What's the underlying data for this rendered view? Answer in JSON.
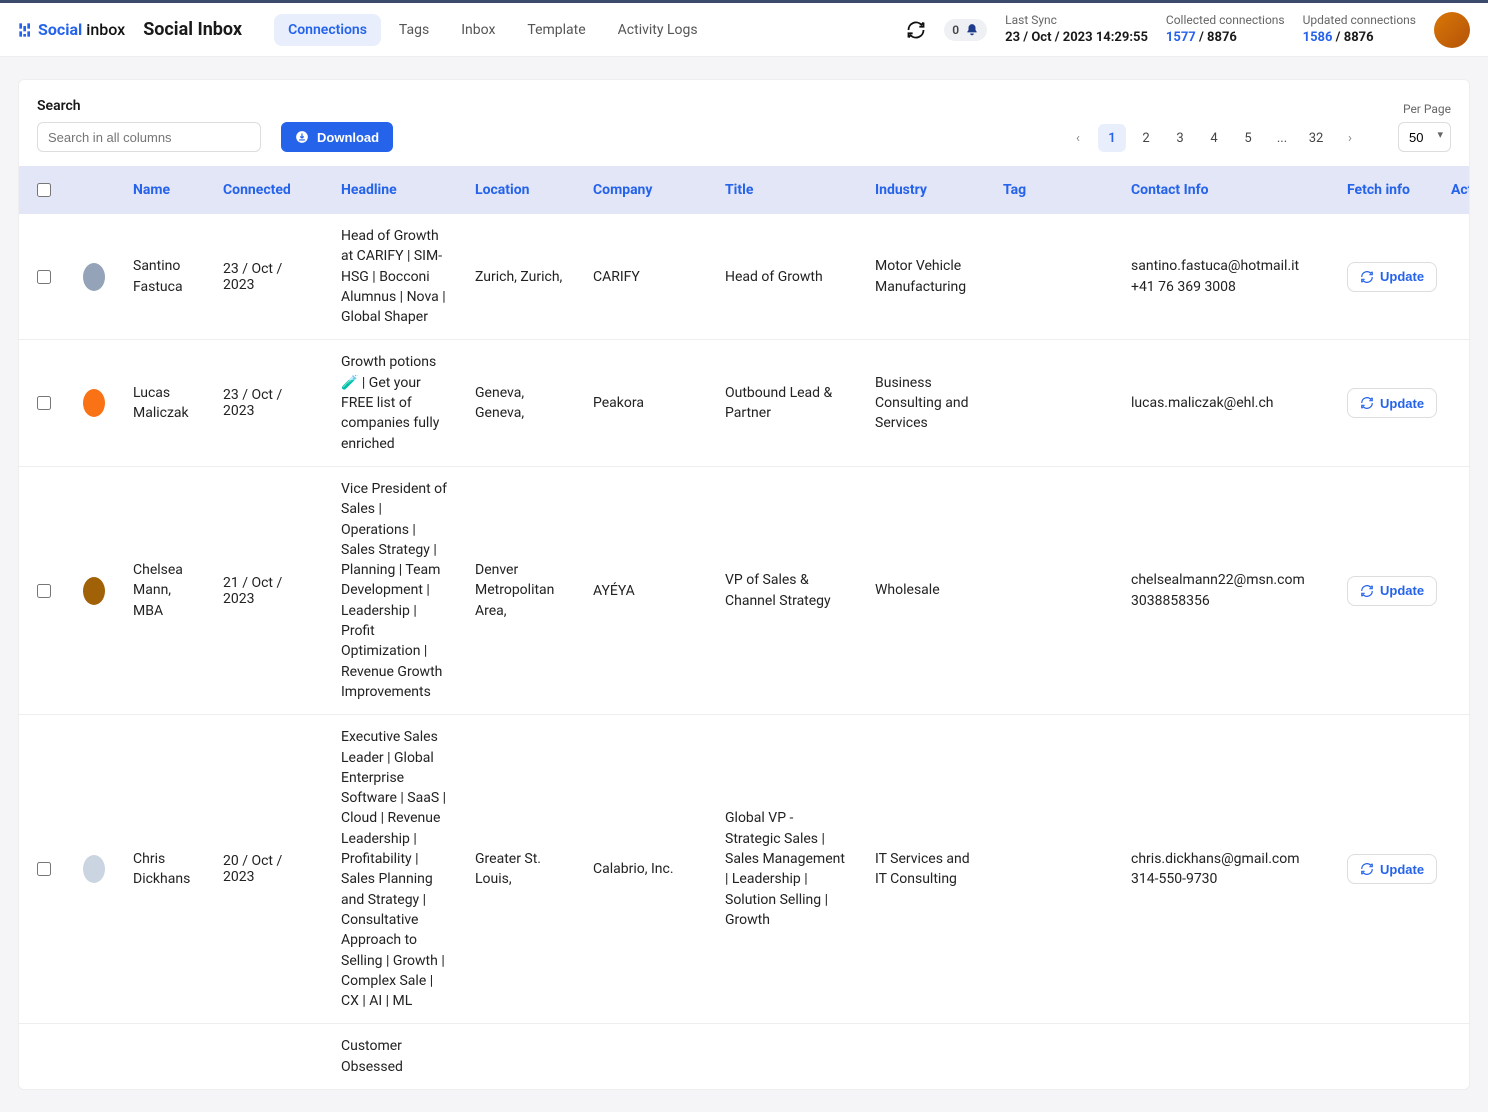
{
  "brand": {
    "social": "Social",
    "inbox": "inbox"
  },
  "app_title": "Social Inbox",
  "nav": [
    "Connections",
    "Tags",
    "Inbox",
    "Template",
    "Activity Logs"
  ],
  "nav_active_index": 0,
  "notif_count": "0",
  "stats": {
    "last_sync": {
      "label": "Last Sync",
      "value": "23 / Oct / 2023 14:29:55"
    },
    "collected": {
      "label": "Collected connections",
      "blue": "1577",
      "rest": " / 8876"
    },
    "updated": {
      "label": "Updated connections",
      "blue": "1586",
      "rest": " / 8876"
    }
  },
  "search": {
    "label": "Search",
    "placeholder": "Search in all columns"
  },
  "download_label": "Download",
  "pagination": {
    "pages": [
      "1",
      "2",
      "3",
      "4",
      "5",
      "...",
      "32"
    ],
    "active_index": 0,
    "per_page_label": "Per Page",
    "per_page_value": "50"
  },
  "columns": [
    "Name",
    "Connected",
    "Headline",
    "Location",
    "Company",
    "Title",
    "Industry",
    "Tag",
    "Contact Info",
    "Fetch info",
    "Action"
  ],
  "update_label": "Update",
  "rows": [
    {
      "name": "Santino Fastuca",
      "connected": "23 / Oct / 2023",
      "headline": "Head of Growth at CARIFY | SIM-HSG | Bocconi Alumnus | Nova | Global Shaper",
      "location": "Zurich, Zurich,",
      "company": "CARIFY",
      "title": "Head of Growth",
      "industry": "Motor Vehicle Manufacturing",
      "contact_email": "santino.fastuca@hotmail.it",
      "contact_phone": "+41 76 369 3008",
      "avatar_bg": "#94a3b8"
    },
    {
      "name": "Lucas Maliczak",
      "connected": "23 / Oct / 2023",
      "headline": "Growth potions 🧪 | Get your FREE list of companies fully enriched",
      "location": "Geneva, Geneva,",
      "company": "Peakora",
      "title": "Outbound Lead & Partner",
      "industry": "Business Consulting and Services",
      "contact_email": "lucas.maliczak@ehl.ch",
      "contact_phone": "",
      "avatar_bg": "#f97316"
    },
    {
      "name": "Chelsea Mann, MBA",
      "connected": "21 / Oct / 2023",
      "headline": "Vice President of Sales | Operations | Sales Strategy | Planning | Team Development | Leadership | Profit Optimization | Revenue Growth Improvements",
      "location": "Denver Metropolitan Area,",
      "company": "AYÉYA",
      "title": "VP of Sales & Channel Strategy",
      "industry": "Wholesale",
      "contact_email": "chelsealmann22@msn.com",
      "contact_phone": "3038858356",
      "avatar_bg": "#a16207"
    },
    {
      "name": "Chris Dickhans",
      "connected": "20 / Oct / 2023",
      "headline": "Executive Sales Leader | Global Enterprise Software | SaaS | Cloud | Revenue Leadership | Profitability | Sales Planning and Strategy | Consultative Approach to Selling | Growth | Complex Sale | CX | AI | ML",
      "location": "Greater St. Louis,",
      "company": "Calabrio, Inc.",
      "title": "Global VP - Strategic Sales | Sales Management | Leadership | Solution Selling | Growth",
      "industry": "IT Services and IT Consulting",
      "contact_email": "chris.dickhans@gmail.com",
      "contact_phone": "314-550-9730",
      "avatar_bg": "#cbd5e1"
    }
  ],
  "partial_row_headline": "Customer Obsessed"
}
